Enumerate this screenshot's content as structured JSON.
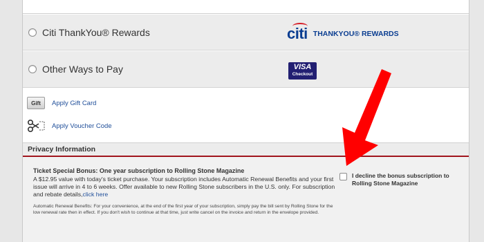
{
  "payment_options": [
    {
      "label": "Citi ThankYou® Rewards",
      "logo_word": "citi",
      "logo_text": "THANKYOU® REWARDS"
    },
    {
      "label": "Other Ways to Pay",
      "badge_word": "VISA",
      "badge_sub": "Checkout"
    }
  ],
  "alternatives": {
    "gift_icon_text": "Gift",
    "gift_card_link": "Apply Gift Card",
    "voucher_link": "Apply Voucher Code"
  },
  "privacy": {
    "title": "Privacy Information"
  },
  "bonus": {
    "title": "Ticket Special Bonus: One year subscription to Rolling Stone Magazine",
    "body": "A $12.95 value with today's ticket purchase. Your subscription includes Automatic Renewal Benefits and your first issue will arrive in 4 to 6 weeks. Offer available to new Rolling Stone subscribers in the U.S. only. For subscription and rebate details,",
    "link": "click here",
    "auto_renewal": "Automatic Renewal Benefits: For your convenience, at the end of the first year of your subscription, simply pay the bill sent by Rolling Stone for the low renewal rate then in effect. If you don't wish to continue at that time, just write cancel on the invoice and return in the envelope provided.",
    "decline_label": "I decline the bonus subscription to Rolling Stone Magazine"
  },
  "colors": {
    "accent_red": "#a0141c",
    "link_blue": "#1f4e99",
    "citi_blue": "#0a3d91",
    "visa_navy": "#221f72",
    "annotation_arrow": "#ff0000"
  }
}
